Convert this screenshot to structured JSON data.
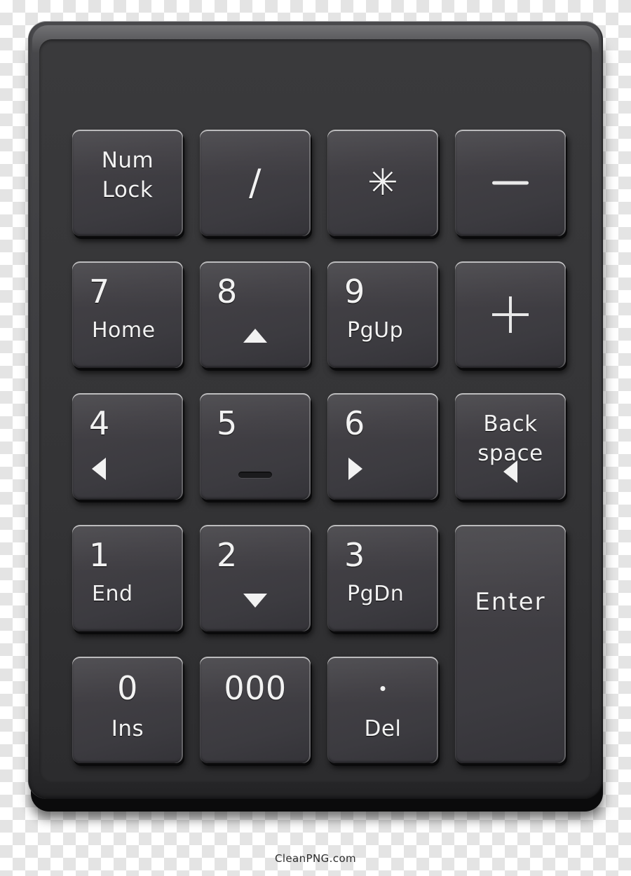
{
  "device": {
    "name": "numeric-keypad",
    "body_color": "#3c3c3f",
    "key_color": "#3f3e42",
    "legend_color": "#f2f2f2",
    "rows": 5,
    "columns": 4
  },
  "keys": [
    {
      "id": "numlock",
      "primary": "Num",
      "secondary": "Lock",
      "style": "stack",
      "mark": "none",
      "col": 1,
      "row": 1,
      "span": 1
    },
    {
      "id": "divide",
      "primary": "/",
      "secondary": "",
      "style": "glyph",
      "mark": "none",
      "col": 2,
      "row": 1,
      "span": 1
    },
    {
      "id": "multiply",
      "primary": "✳",
      "secondary": "",
      "style": "glyph",
      "mark": "none",
      "col": 3,
      "row": 1,
      "span": 1
    },
    {
      "id": "minus",
      "primary": "",
      "secondary": "",
      "style": "glyph",
      "mark": "dash",
      "col": 4,
      "row": 1,
      "span": 1
    },
    {
      "id": "num7",
      "primary": "7",
      "secondary": "Home",
      "style": "digit",
      "mark": "none",
      "col": 1,
      "row": 2,
      "span": 1
    },
    {
      "id": "num8",
      "primary": "8",
      "secondary": "",
      "style": "digit",
      "mark": "arrow-up",
      "col": 2,
      "row": 2,
      "span": 1
    },
    {
      "id": "num9",
      "primary": "9",
      "secondary": "PgUp",
      "style": "digit",
      "mark": "none",
      "col": 3,
      "row": 2,
      "span": 1
    },
    {
      "id": "plus",
      "primary": "",
      "secondary": "",
      "style": "glyph",
      "mark": "plus",
      "col": 4,
      "row": 2,
      "span": 1
    },
    {
      "id": "num4",
      "primary": "4",
      "secondary": "",
      "style": "digit",
      "mark": "arrow-left",
      "col": 1,
      "row": 3,
      "span": 1
    },
    {
      "id": "num5",
      "primary": "5",
      "secondary": "",
      "style": "digit",
      "mark": "home-bar",
      "col": 2,
      "row": 3,
      "span": 1
    },
    {
      "id": "num6",
      "primary": "6",
      "secondary": "",
      "style": "digit",
      "mark": "arrow-right",
      "col": 3,
      "row": 3,
      "span": 1
    },
    {
      "id": "backspace",
      "primary": "Back",
      "secondary": "space",
      "style": "stack",
      "mark": "arrow-left-c",
      "col": 4,
      "row": 3,
      "span": 1
    },
    {
      "id": "num1",
      "primary": "1",
      "secondary": "End",
      "style": "digit",
      "mark": "none",
      "col": 1,
      "row": 4,
      "span": 1
    },
    {
      "id": "num2",
      "primary": "2",
      "secondary": "",
      "style": "digit",
      "mark": "arrow-down",
      "col": 2,
      "row": 4,
      "span": 1
    },
    {
      "id": "num3",
      "primary": "3",
      "secondary": "PgDn",
      "style": "digit",
      "mark": "none",
      "col": 3,
      "row": 4,
      "span": 1
    },
    {
      "id": "enter",
      "primary": "Enter",
      "secondary": "",
      "style": "tall",
      "mark": "none",
      "col": 4,
      "row": 4,
      "span": 2
    },
    {
      "id": "num0",
      "primary": "0",
      "secondary": "Ins",
      "style": "center",
      "mark": "none",
      "col": 1,
      "row": 5,
      "span": 1
    },
    {
      "id": "triple0",
      "primary": "000",
      "secondary": "",
      "style": "center-only",
      "mark": "none",
      "col": 2,
      "row": 5,
      "span": 1
    },
    {
      "id": "decimal",
      "primary": "",
      "secondary": "Del",
      "style": "center",
      "mark": "dot",
      "col": 3,
      "row": 5,
      "span": 1
    }
  ],
  "watermark": {
    "text": "CleanPNG.com"
  }
}
